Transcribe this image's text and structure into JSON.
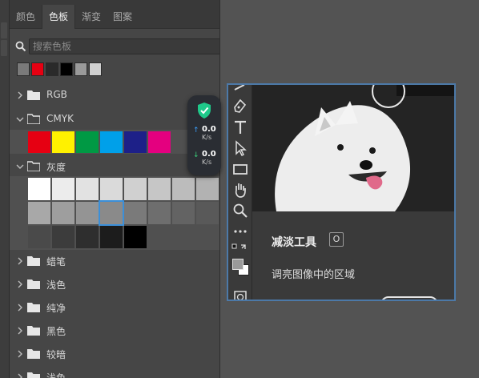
{
  "tabs": [
    {
      "label": "颜色",
      "active": false
    },
    {
      "label": "色板",
      "active": true
    },
    {
      "label": "渐变",
      "active": false
    },
    {
      "label": "图案",
      "active": false
    }
  ],
  "search": {
    "placeholder": "搜索色板",
    "icon": "search-icon"
  },
  "recent_swatches": [
    "#7a7a7a",
    "#e60012",
    "#2a2a2a",
    "#000000",
    "#9a9a9a",
    "#d0d0d0"
  ],
  "groups": {
    "rgb": {
      "label": "RGB",
      "expanded": false
    },
    "cmyk": {
      "label": "CMYK",
      "expanded": true,
      "swatches": [
        "#e60012",
        "#fff100",
        "#009944",
        "#00a0e9",
        "#1d2088",
        "#e4007f"
      ]
    },
    "gray": {
      "label": "灰度",
      "expanded": true
    },
    "crayon": {
      "label": "蜡笔",
      "expanded": false
    },
    "light": {
      "label": "浅色",
      "expanded": false
    },
    "pure": {
      "label": "纯净",
      "expanded": false
    },
    "dark": {
      "label": "黑色",
      "expanded": false
    },
    "darker": {
      "label": "较暗",
      "expanded": false
    },
    "partial": {
      "label": "浅色",
      "expanded": false
    }
  },
  "gray_rows": [
    [
      "#ffffff",
      "#ececec",
      "#e2e2e2",
      "#dadada",
      "#d0d0d0",
      "#c6c6c6",
      "#bcbcbc",
      "#b2b2b2"
    ],
    [
      "#a8a8a8",
      "#9e9e9e",
      "#949494",
      "#8a8a8a",
      "#7a7a7a",
      "#6e6e6e",
      "#636363",
      "#595959"
    ],
    [
      "#4a4a4a",
      "#3c3c3c",
      "#2e2e2e",
      "#1c1c1c",
      "#000000"
    ]
  ],
  "selected_gray": "#8a8a8a",
  "network": {
    "up_value": "0.0",
    "up_unit": "K/s",
    "down_value": "0.0",
    "down_unit": "K/s",
    "up_color": "#3aa0ff",
    "down_color": "#3ad07a",
    "shield_color": "#1fc98a"
  },
  "tooltip": {
    "title": "减淡工具",
    "shortcut": "O",
    "description": "调亮图像中的区域"
  },
  "accent": "#4c79a8"
}
